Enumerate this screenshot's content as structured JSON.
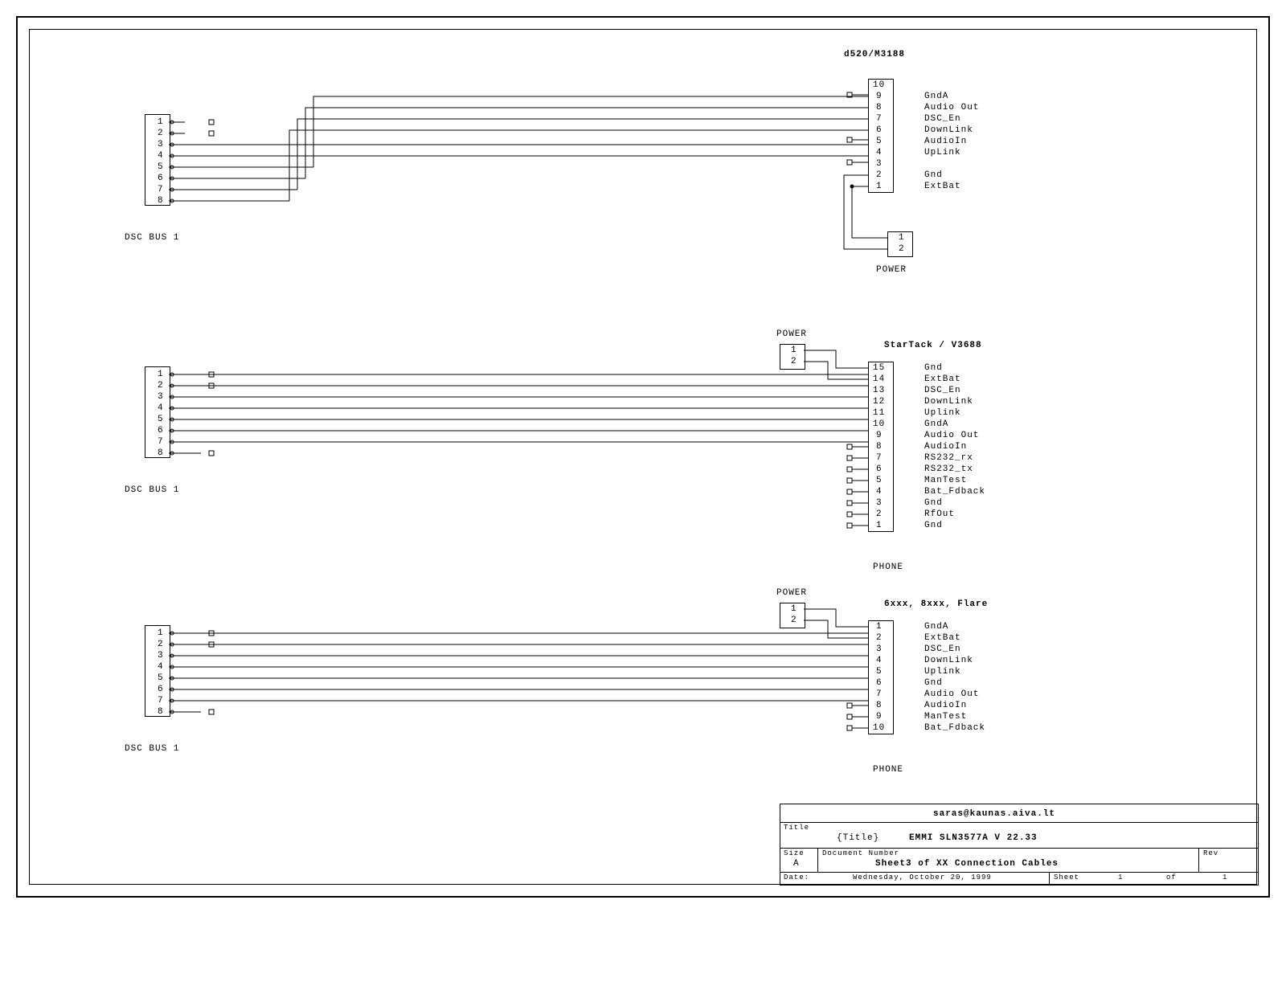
{
  "sections": {
    "s1": {
      "title": "d520/M3188",
      "dsc_label": "DSC BUS 1",
      "dsc_pins": [
        "1",
        "2",
        "3",
        "4",
        "5",
        "6",
        "7",
        "8"
      ],
      "conn_pins": [
        "10",
        "9",
        "8",
        "7",
        "6",
        "5",
        "4",
        "3",
        "2",
        "1"
      ],
      "signals": [
        "",
        "GndA",
        "Audio Out",
        "DSC_En",
        "DownLink",
        "AudioIn",
        "UpLink",
        "",
        "Gnd",
        "ExtBat"
      ],
      "power_label": "POWER",
      "power_pins": [
        "1",
        "2"
      ]
    },
    "s2": {
      "title": "StarTack / V3688",
      "dsc_label": "DSC BUS 1",
      "dsc_pins": [
        "1",
        "2",
        "3",
        "4",
        "5",
        "6",
        "7",
        "8"
      ],
      "conn_pins": [
        "15",
        "14",
        "13",
        "12",
        "11",
        "10",
        "9",
        "8",
        "7",
        "6",
        "5",
        "4",
        "3",
        "2",
        "1"
      ],
      "signals": [
        "Gnd",
        "ExtBat",
        "DSC_En",
        "DownLink",
        "Uplink",
        "GndA",
        "Audio Out",
        "AudioIn",
        "RS232_rx",
        "RS232_tx",
        "ManTest",
        "Bat_Fdback",
        "Gnd",
        "RfOut",
        "Gnd"
      ],
      "power_label": "POWER",
      "power_pins": [
        "1",
        "2"
      ],
      "phone_label": "PHONE"
    },
    "s3": {
      "title": "6xxx, 8xxx, Flare",
      "dsc_label": "DSC BUS 1",
      "dsc_pins": [
        "1",
        "2",
        "3",
        "4",
        "5",
        "6",
        "7",
        "8"
      ],
      "conn_pins": [
        "1",
        "2",
        "3",
        "4",
        "5",
        "6",
        "7",
        "8",
        "9",
        "10"
      ],
      "signals": [
        "GndA",
        "ExtBat",
        "DSC_En",
        "DownLink",
        "Uplink",
        "Gnd",
        "Audio Out",
        "AudioIn",
        "ManTest",
        "Bat_Fdback"
      ],
      "power_label": "POWER",
      "power_pins": [
        "1",
        "2"
      ],
      "phone_label": "PHONE"
    }
  },
  "titleblock": {
    "email": "saras@kaunas.aiva.lt",
    "title_label": "Title",
    "title_prefix": "{Title}",
    "title_text": "EMMI  SLN3577A    V 22.33",
    "size_label": "Size",
    "size_value": "A",
    "doc_label": "Document Number",
    "doc_value": "Sheet3 of XX Connection Cables",
    "rev_label": "Rev",
    "date_label": "Date:",
    "date_value": "Wednesday, October 20, 1999",
    "sheet_label": "Sheet",
    "sheet_num": "1",
    "of_label": "of",
    "sheet_total": "1"
  }
}
